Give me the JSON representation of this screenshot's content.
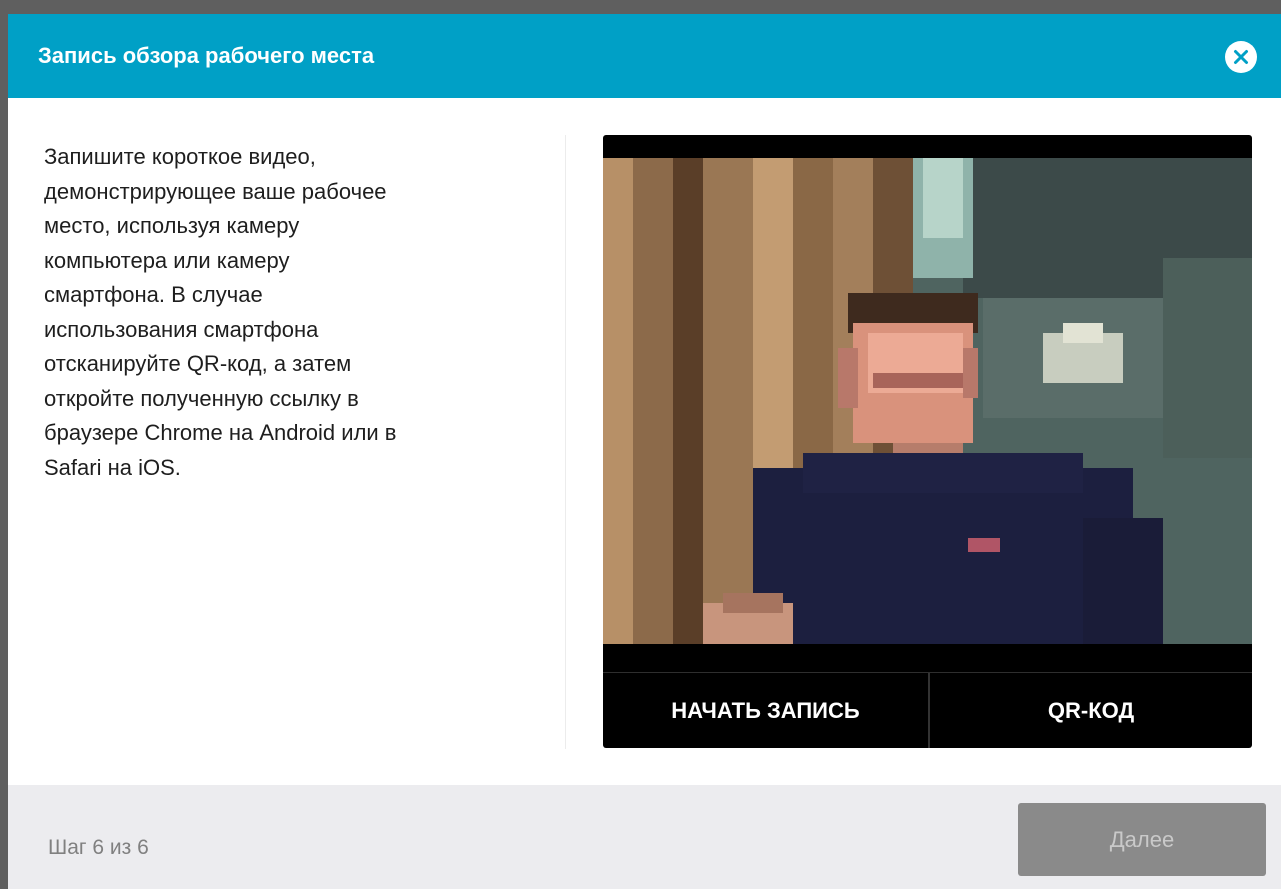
{
  "dialog": {
    "title": "Запись обзора рабочего места",
    "close_icon": "close-icon",
    "header_color": "#00a0c6"
  },
  "instructions": {
    "text": "Запишите короткое видео,\nдемонстрирующее ваше рабочее\nместо, используя камеру\nкомпьютера или камеру\nсмартфона. В случае\nиспользования смартфона\nотсканируйте QR-код, а затем\nоткройте полученную ссылку в\nбраузере Chrome на Android или в\nSafari на iOS."
  },
  "video": {
    "start_label": "НАЧАТЬ ЗАПИСЬ",
    "qr_label": "QR-КОД"
  },
  "footer": {
    "step_text": "Шаг 6 из 6",
    "next_label": "Далее",
    "next_disabled": true
  }
}
